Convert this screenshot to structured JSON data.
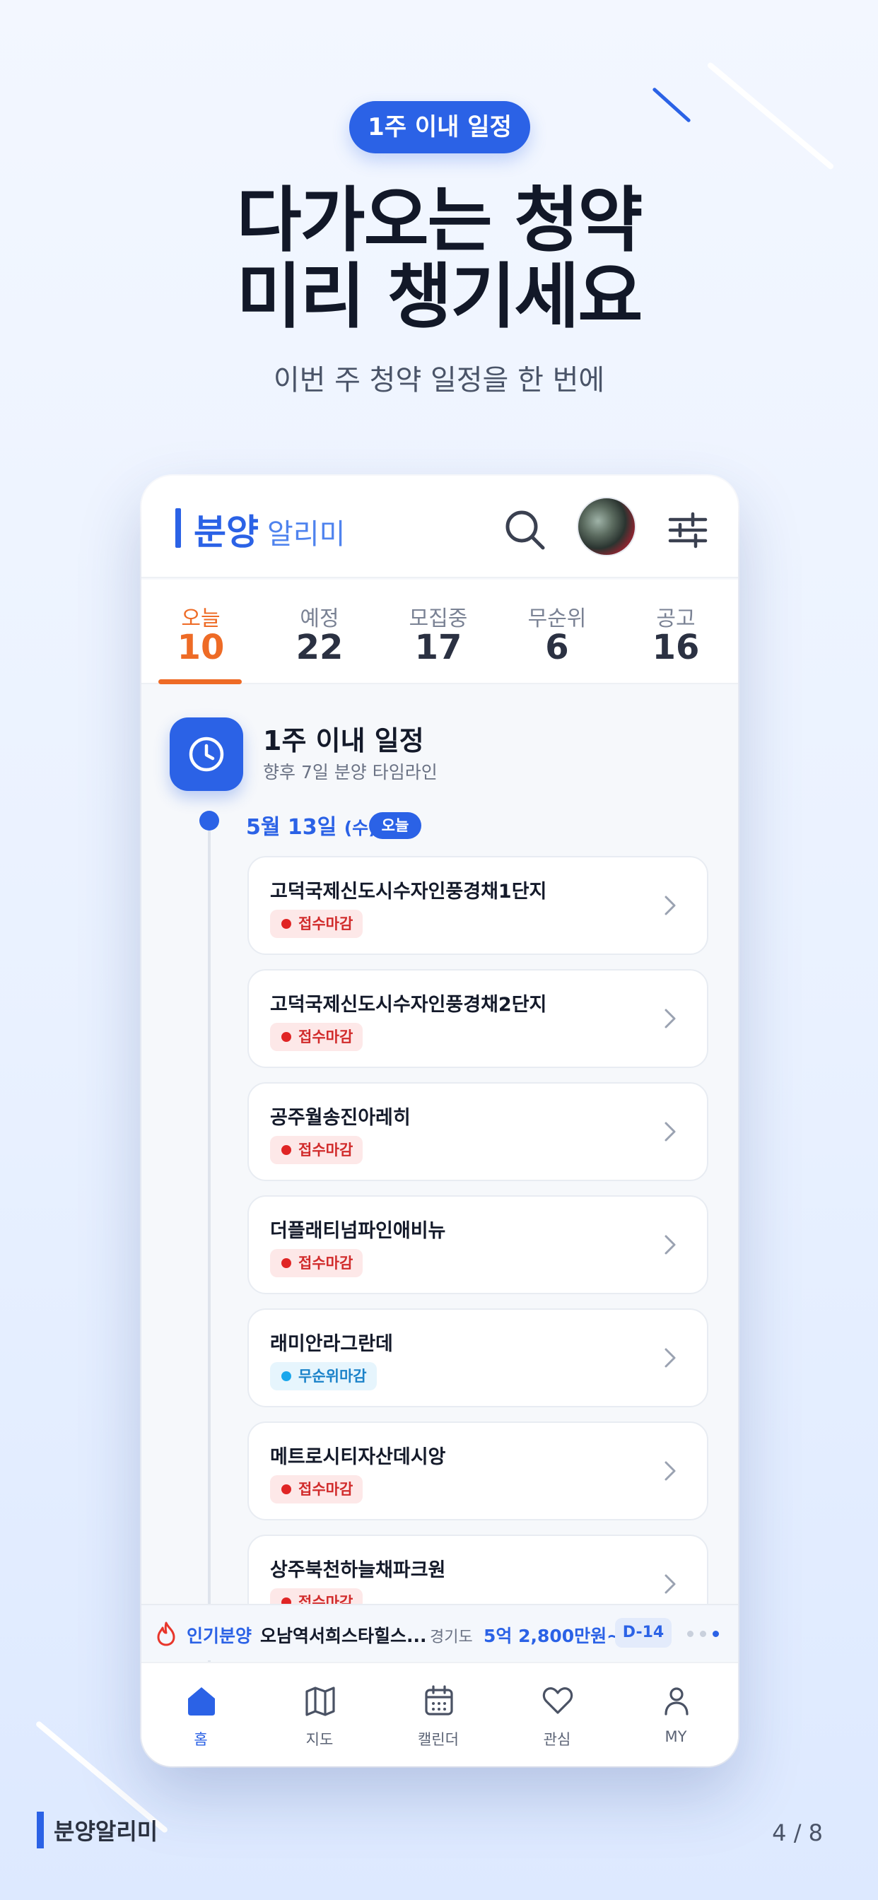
{
  "hero": {
    "badge": "1주 이내 일정",
    "title_line1": "다가오는 청약",
    "title_line2": "미리 챙기세요",
    "subtitle": "이번 주 청약 일정을 한 번에"
  },
  "app": {
    "logo_main": "분양",
    "logo_sub": "알리미",
    "tabs": [
      {
        "label": "오늘",
        "count": "10",
        "active": true
      },
      {
        "label": "예정",
        "count": "22"
      },
      {
        "label": "모집중",
        "count": "17"
      },
      {
        "label": "무순위",
        "count": "6"
      },
      {
        "label": "공고",
        "count": "16"
      }
    ],
    "section": {
      "title": "1주 이내 일정",
      "subtitle": "향후 7일 분양 타임라인"
    },
    "timeline": {
      "date": "5월 13일",
      "weekday": "(수)",
      "today_badge": "오늘"
    },
    "cards": [
      {
        "name": "고덕국제신도시수자인풍경채1단지",
        "tag": "접수마감",
        "tag_type": "red"
      },
      {
        "name": "고덕국제신도시수자인풍경채2단지",
        "tag": "접수마감",
        "tag_type": "red"
      },
      {
        "name": "공주월송진아레히",
        "tag": "접수마감",
        "tag_type": "red"
      },
      {
        "name": "더플래티넘파인애비뉴",
        "tag": "접수마감",
        "tag_type": "red"
      },
      {
        "name": "래미안라그란데",
        "tag": "무순위마감",
        "tag_type": "blue"
      },
      {
        "name": "메트로시티자산데시앙",
        "tag": "접수마감",
        "tag_type": "red"
      },
      {
        "name": "상주북천하늘채파크원",
        "tag": "접수마감",
        "tag_type": "red"
      }
    ],
    "ticker": {
      "label": "인기분양",
      "name": "오남역서희스타힐스...",
      "region": "경기도",
      "price": "5억 2,800만원~",
      "dday": "D-14"
    },
    "nav": [
      {
        "label": "홈",
        "icon": "home-icon",
        "active": true
      },
      {
        "label": "지도",
        "icon": "map-icon"
      },
      {
        "label": "캘린더",
        "icon": "calendar-icon"
      },
      {
        "label": "관심",
        "icon": "heart-icon"
      },
      {
        "label": "MY",
        "icon": "user-icon"
      }
    ],
    "colors": {
      "primary": "#2b62e6",
      "accent": "#ee6b26",
      "deadline_red": "#e02525",
      "deadline_blue": "#1aa7ec"
    }
  },
  "footer": {
    "brand": "분양알리미",
    "page": "4 / 8"
  }
}
